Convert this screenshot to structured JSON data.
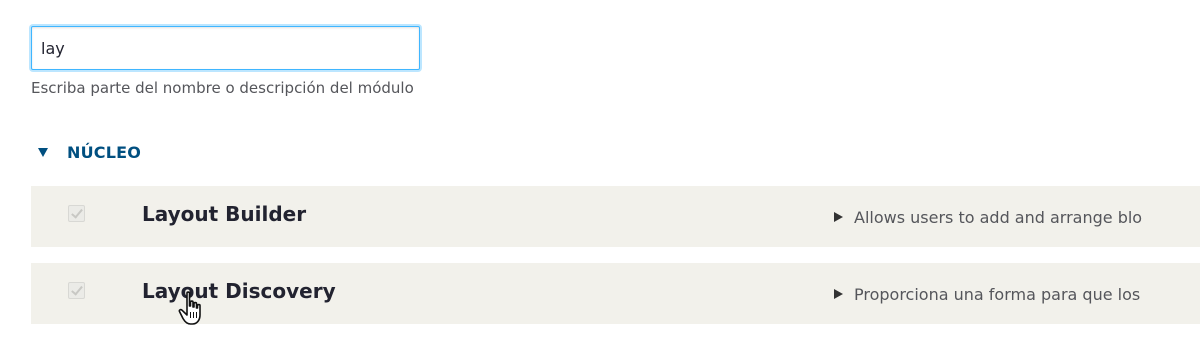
{
  "filter": {
    "value": "lay",
    "description": "Escriba parte del nombre o descripción del módulo"
  },
  "package": {
    "label": "NÚCLEO",
    "icon": "triangle-down-icon"
  },
  "modules": [
    {
      "name": "Layout Builder",
      "description": "Allows users to add and arrange blo",
      "enabled": true
    },
    {
      "name": "Layout Discovery",
      "description": "Proporciona una forma para que los",
      "enabled": true
    }
  ],
  "colors": {
    "accent": "#004f80",
    "focus": "#40b6ff",
    "row_background": "#f2f1eb"
  },
  "cursor": "hand-pointer-icon"
}
